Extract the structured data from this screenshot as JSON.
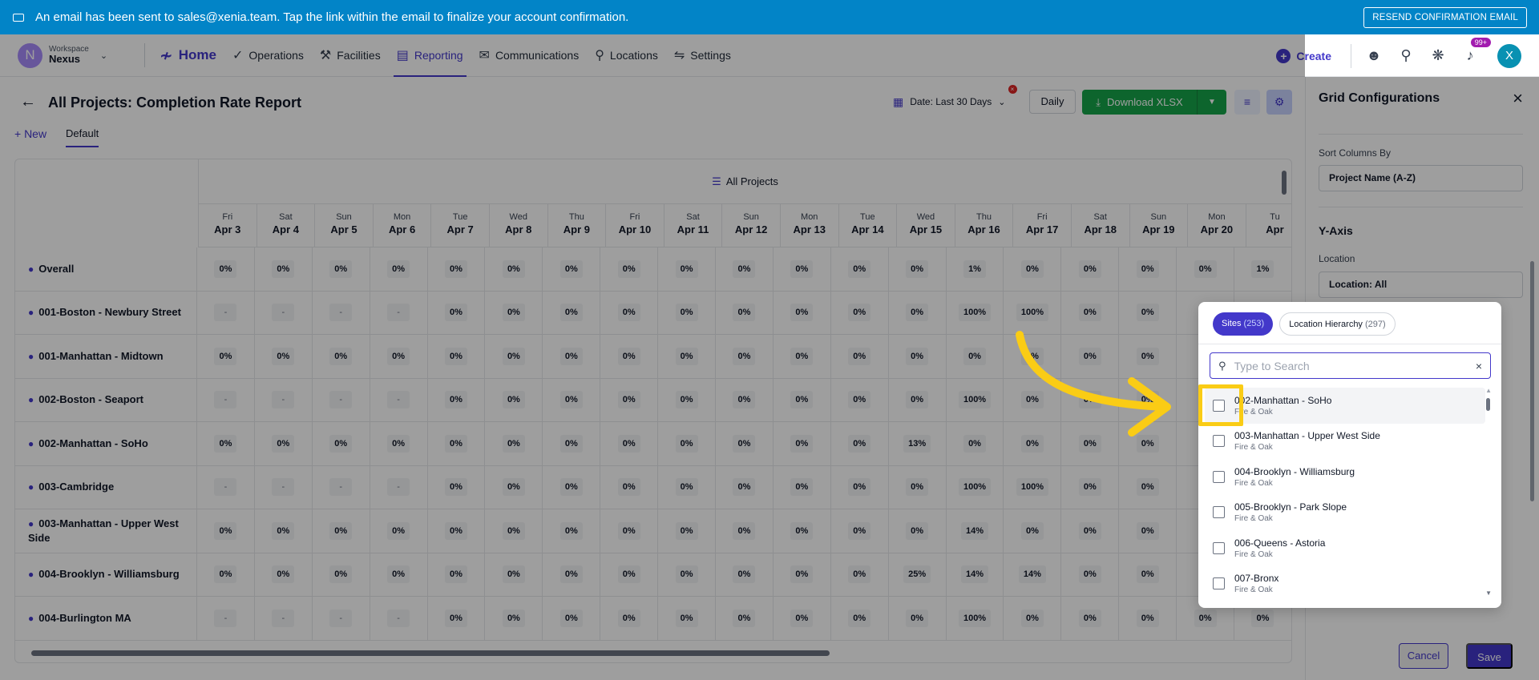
{
  "banner": {
    "message": "An email has been sent to sales@xenia.team. Tap the link within the email to finalize your account confirmation.",
    "resend_label": "RESEND CONFIRMATION EMAIL"
  },
  "workspace": {
    "initial": "N",
    "label": "Workspace",
    "name": "Nexus"
  },
  "nav": {
    "home": "Home",
    "items": [
      "Operations",
      "Facilities",
      "Reporting",
      "Communications",
      "Locations",
      "Settings"
    ],
    "create": "Create",
    "notif_badge": "99+",
    "user_initial": "X"
  },
  "page": {
    "title": "All Projects: Completion Rate Report",
    "tab_new": "+ New",
    "tab_default": "Default",
    "date_label": "Date: Last 30 Days",
    "daily": "Daily",
    "download": "Download XLSX"
  },
  "grid": {
    "group_title": "All Projects",
    "columns": [
      {
        "d": "Fri",
        "n": "Apr 3"
      },
      {
        "d": "Sat",
        "n": "Apr 4"
      },
      {
        "d": "Sun",
        "n": "Apr 5"
      },
      {
        "d": "Mon",
        "n": "Apr 6"
      },
      {
        "d": "Tue",
        "n": "Apr 7"
      },
      {
        "d": "Wed",
        "n": "Apr 8"
      },
      {
        "d": "Thu",
        "n": "Apr 9"
      },
      {
        "d": "Fri",
        "n": "Apr 10"
      },
      {
        "d": "Sat",
        "n": "Apr 11"
      },
      {
        "d": "Sun",
        "n": "Apr 12"
      },
      {
        "d": "Mon",
        "n": "Apr 13"
      },
      {
        "d": "Tue",
        "n": "Apr 14"
      },
      {
        "d": "Wed",
        "n": "Apr 15"
      },
      {
        "d": "Thu",
        "n": "Apr 16"
      },
      {
        "d": "Fri",
        "n": "Apr 17"
      },
      {
        "d": "Sat",
        "n": "Apr 18"
      },
      {
        "d": "Sun",
        "n": "Apr 19"
      },
      {
        "d": "Mon",
        "n": "Apr 20"
      },
      {
        "d": "Tu",
        "n": "Apr"
      }
    ],
    "rows": [
      {
        "label": "Overall",
        "cells": [
          "0%",
          "0%",
          "0%",
          "0%",
          "0%",
          "0%",
          "0%",
          "0%",
          "0%",
          "0%",
          "0%",
          "0%",
          "0%",
          "1%",
          "0%",
          "0%",
          "0%",
          "0%",
          "1%"
        ]
      },
      {
        "label": "001-Boston - Newbury Street",
        "cells": [
          "-",
          "-",
          "-",
          "-",
          "0%",
          "0%",
          "0%",
          "0%",
          "0%",
          "0%",
          "0%",
          "0%",
          "0%",
          "100%",
          "100%",
          "0%",
          "0%",
          "",
          ""
        ]
      },
      {
        "label": "001-Manhattan - Midtown",
        "cells": [
          "0%",
          "0%",
          "0%",
          "0%",
          "0%",
          "0%",
          "0%",
          "0%",
          "0%",
          "0%",
          "0%",
          "0%",
          "0%",
          "0%",
          "0%",
          "0%",
          "0%",
          "",
          ""
        ]
      },
      {
        "label": "002-Boston - Seaport",
        "cells": [
          "-",
          "-",
          "-",
          "-",
          "0%",
          "0%",
          "0%",
          "0%",
          "0%",
          "0%",
          "0%",
          "0%",
          "0%",
          "100%",
          "0%",
          "0%",
          "0%",
          "",
          ""
        ]
      },
      {
        "label": "002-Manhattan - SoHo",
        "cells": [
          "0%",
          "0%",
          "0%",
          "0%",
          "0%",
          "0%",
          "0%",
          "0%",
          "0%",
          "0%",
          "0%",
          "0%",
          "13%",
          "0%",
          "0%",
          "0%",
          "0%",
          "",
          ""
        ]
      },
      {
        "label": "003-Cambridge",
        "cells": [
          "-",
          "-",
          "-",
          "-",
          "0%",
          "0%",
          "0%",
          "0%",
          "0%",
          "0%",
          "0%",
          "0%",
          "0%",
          "100%",
          "100%",
          "0%",
          "0%",
          "",
          ""
        ]
      },
      {
        "label": "003-Manhattan - Upper West Side",
        "cells": [
          "0%",
          "0%",
          "0%",
          "0%",
          "0%",
          "0%",
          "0%",
          "0%",
          "0%",
          "0%",
          "0%",
          "0%",
          "0%",
          "14%",
          "0%",
          "0%",
          "0%",
          "",
          ""
        ]
      },
      {
        "label": "004-Brooklyn - Williamsburg",
        "cells": [
          "0%",
          "0%",
          "0%",
          "0%",
          "0%",
          "0%",
          "0%",
          "0%",
          "0%",
          "0%",
          "0%",
          "0%",
          "25%",
          "14%",
          "14%",
          "0%",
          "0%",
          "",
          ""
        ]
      },
      {
        "label": "004-Burlington MA",
        "cells": [
          "-",
          "-",
          "-",
          "-",
          "0%",
          "0%",
          "0%",
          "0%",
          "0%",
          "0%",
          "0%",
          "0%",
          "0%",
          "100%",
          "0%",
          "0%",
          "0%",
          "0%",
          "0%"
        ]
      }
    ]
  },
  "side": {
    "title": "Grid Configurations",
    "sort_label": "Sort Columns By",
    "sort_value": "Project Name (A-Z)",
    "yaxis": "Y-Axis",
    "location_label": "Location",
    "location_value": "Location: All",
    "cancel": "Cancel",
    "save": "Save"
  },
  "popover": {
    "tab_sites": "Sites",
    "tab_sites_count": "(253)",
    "tab_hier": "Location Hierarchy",
    "tab_hier_count": "(297)",
    "search_placeholder": "Type to Search",
    "items": [
      {
        "t": "002-Manhattan - SoHo",
        "s": "Fire & Oak"
      },
      {
        "t": "003-Manhattan - Upper West Side",
        "s": "Fire & Oak"
      },
      {
        "t": "004-Brooklyn - Williamsburg",
        "s": "Fire & Oak"
      },
      {
        "t": "005-Brooklyn - Park Slope",
        "s": "Fire & Oak"
      },
      {
        "t": "006-Queens - Astoria",
        "s": "Fire & Oak"
      },
      {
        "t": "007-Bronx",
        "s": "Fire & Oak"
      }
    ]
  },
  "colors": {
    "banner": "#0284c7",
    "accent": "#4338ca",
    "download": "#16a34a",
    "highlight": "#facc15"
  }
}
